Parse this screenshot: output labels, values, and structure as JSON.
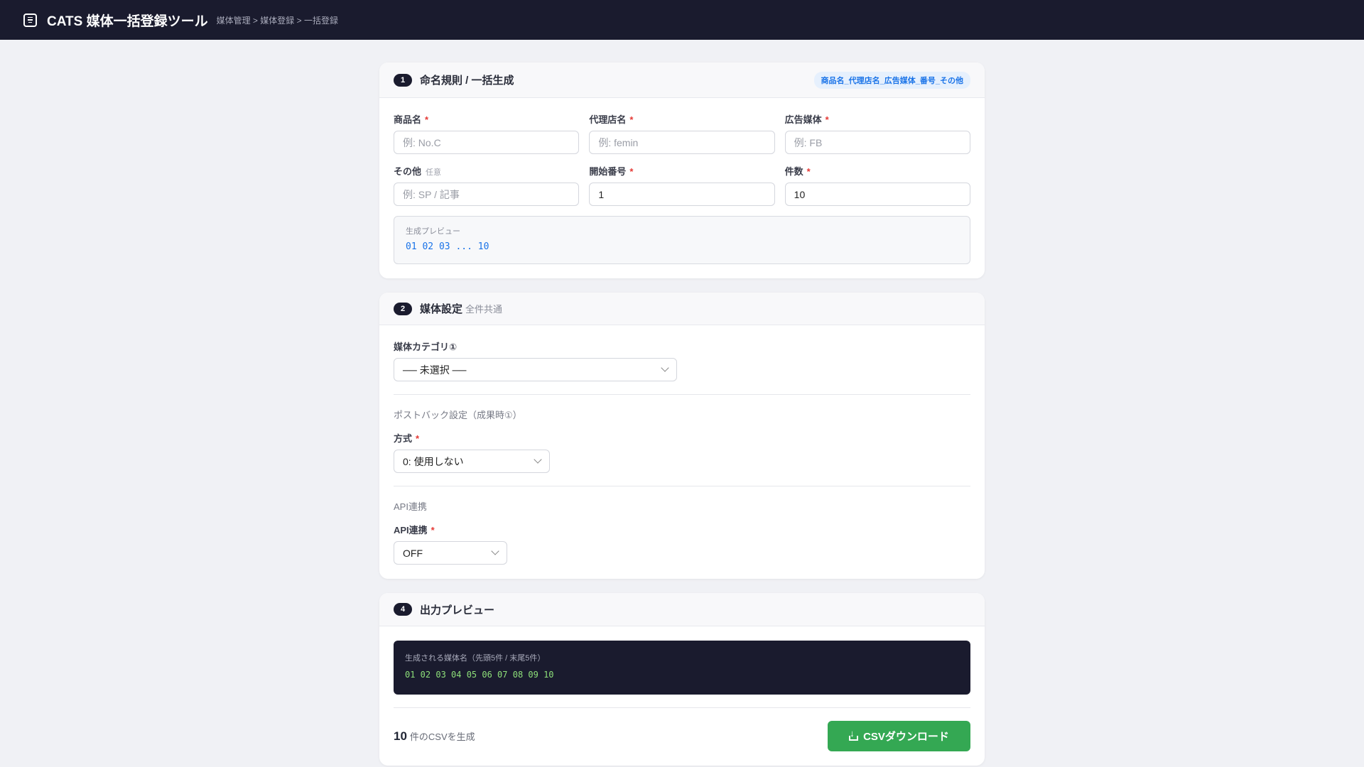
{
  "header": {
    "title": "CATS 媒体一括登録ツール",
    "breadcrumb": "媒体管理 > 媒体登録 > 一括登録"
  },
  "section1": {
    "step": "1",
    "title": "命名規則 / 一括生成",
    "pattern_badge": "商品名_代理店名_広告媒体_番号_その他",
    "fields": [
      {
        "label": "商品名",
        "required": "*",
        "placeholder": "例: No.C",
        "value": ""
      },
      {
        "label": "代理店名",
        "required": "*",
        "placeholder": "例: femin",
        "value": ""
      },
      {
        "label": "広告媒体",
        "required": "*",
        "placeholder": "例: FB",
        "value": ""
      },
      {
        "label": "その他",
        "optional": "任意",
        "placeholder": "例: SP / 記事",
        "value": ""
      },
      {
        "label": "開始番号",
        "required": "*",
        "placeholder": "",
        "value": "1"
      },
      {
        "label": "件数",
        "required": "*",
        "placeholder": "",
        "value": "10"
      }
    ],
    "preview_label": "生成プレビュー",
    "preview_value": "01 02 03 ... 10"
  },
  "section2": {
    "step": "2",
    "title": "媒体設定",
    "subtitle": "全件共通",
    "category_label": "媒体カテゴリ①",
    "category_value": "── 未選択 ──",
    "postback_heading": "ポストバック設定（成果時①）",
    "method_label": "方式",
    "method_required": "*",
    "method_value": "0: 使用しない",
    "api_heading": "API連携",
    "api_label": "API連携",
    "api_required": "*",
    "api_value": "OFF"
  },
  "section4": {
    "step": "4",
    "title": "出力プレビュー",
    "output_label": "生成される媒体名（先頭5件 / 末尾5件）",
    "output_value": "01 02 03 04 05 06 07 08 09 10",
    "count": "10",
    "count_label": "件のCSVを生成",
    "download_label": "CSVダウンロード"
  },
  "colors": {
    "accent": "#1a73e8",
    "dark": "#1a1b2e",
    "success": "#34a853",
    "required": "#e53935"
  }
}
